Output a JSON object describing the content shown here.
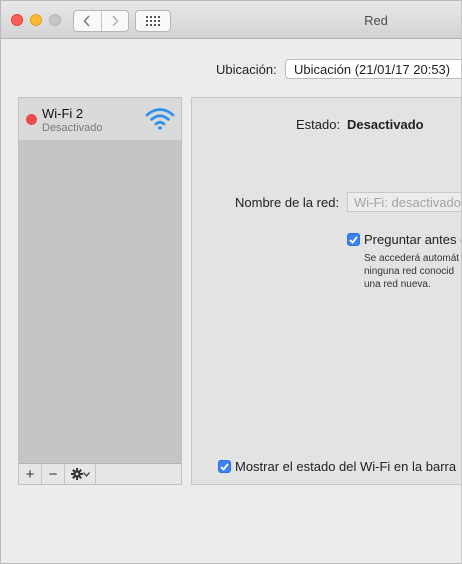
{
  "window": {
    "title": "Red"
  },
  "location": {
    "label": "Ubicación:",
    "value": "Ubicación (21/01/17 20:53)"
  },
  "services": [
    {
      "name": "Wi-Fi 2",
      "status": "Desactivado",
      "status_color": "#ef4d4d",
      "icon": "wifi-icon"
    }
  ],
  "sidebar_toolbar": {
    "add": "+",
    "remove": "−",
    "gear": "gear-icon"
  },
  "panel": {
    "status_label": "Estado:",
    "status_value": "Desactivado",
    "network_name_label": "Nombre de la red:",
    "network_name_value": "Wi-Fi: desactivado",
    "ask_join": {
      "checked": true,
      "label": "Preguntar antes c"
    },
    "ask_desc_lines": [
      "Se accederá automát",
      "ninguna red conocid",
      "una red nueva."
    ],
    "show_status": {
      "checked": true,
      "label": "Mostrar el estado del Wi-Fi en la barra"
    }
  },
  "colors": {
    "accent": "#3b82f6",
    "close": "#fc5f57",
    "minimize": "#fdbc2e",
    "wifi": "#2b8ef0"
  }
}
